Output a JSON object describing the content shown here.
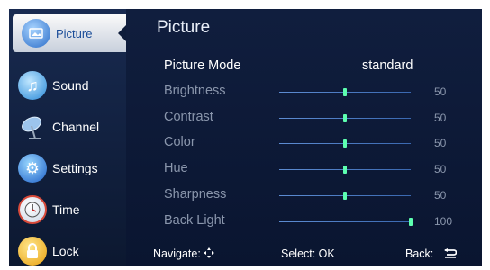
{
  "sidebar": {
    "items": [
      {
        "label": "Picture",
        "icon": "picture-icon",
        "active": true,
        "color": "#4a8ee0"
      },
      {
        "label": "Sound",
        "icon": "music-note-icon",
        "active": false,
        "color": "#4aa8e8"
      },
      {
        "label": "Channel",
        "icon": "satellite-dish-icon",
        "active": false,
        "color": "#6aa0d8"
      },
      {
        "label": "Settings",
        "icon": "gear-icon",
        "active": false,
        "color": "#3a80e0"
      },
      {
        "label": "Time",
        "icon": "clock-icon",
        "active": false,
        "color": "#d84a3a"
      },
      {
        "label": "Lock",
        "icon": "padlock-icon",
        "active": false,
        "color": "#f0b020"
      }
    ]
  },
  "main": {
    "title": "Picture",
    "mode": {
      "label": "Picture Mode",
      "value": "standard"
    },
    "settings": [
      {
        "label": "Brightness",
        "value": 50,
        "level": 0.5
      },
      {
        "label": "Contrast",
        "value": 50,
        "level": 0.5
      },
      {
        "label": "Color",
        "value": 50,
        "level": 0.5
      },
      {
        "label": "Hue",
        "value": 50,
        "level": 0.5
      },
      {
        "label": "Sharpness",
        "value": 50,
        "level": 0.5
      },
      {
        "label": "Back Light",
        "value": 100,
        "level": 1.0
      }
    ]
  },
  "footer": {
    "navigate_label": "Navigate:",
    "navigate_icon": "four-way-arrow-icon",
    "select_label": "Select: OK",
    "back_label": "Back:",
    "back_icon": "return-arrow-icon"
  },
  "colors": {
    "accent": "#5dffb0",
    "panel": "#0e1c3a"
  }
}
